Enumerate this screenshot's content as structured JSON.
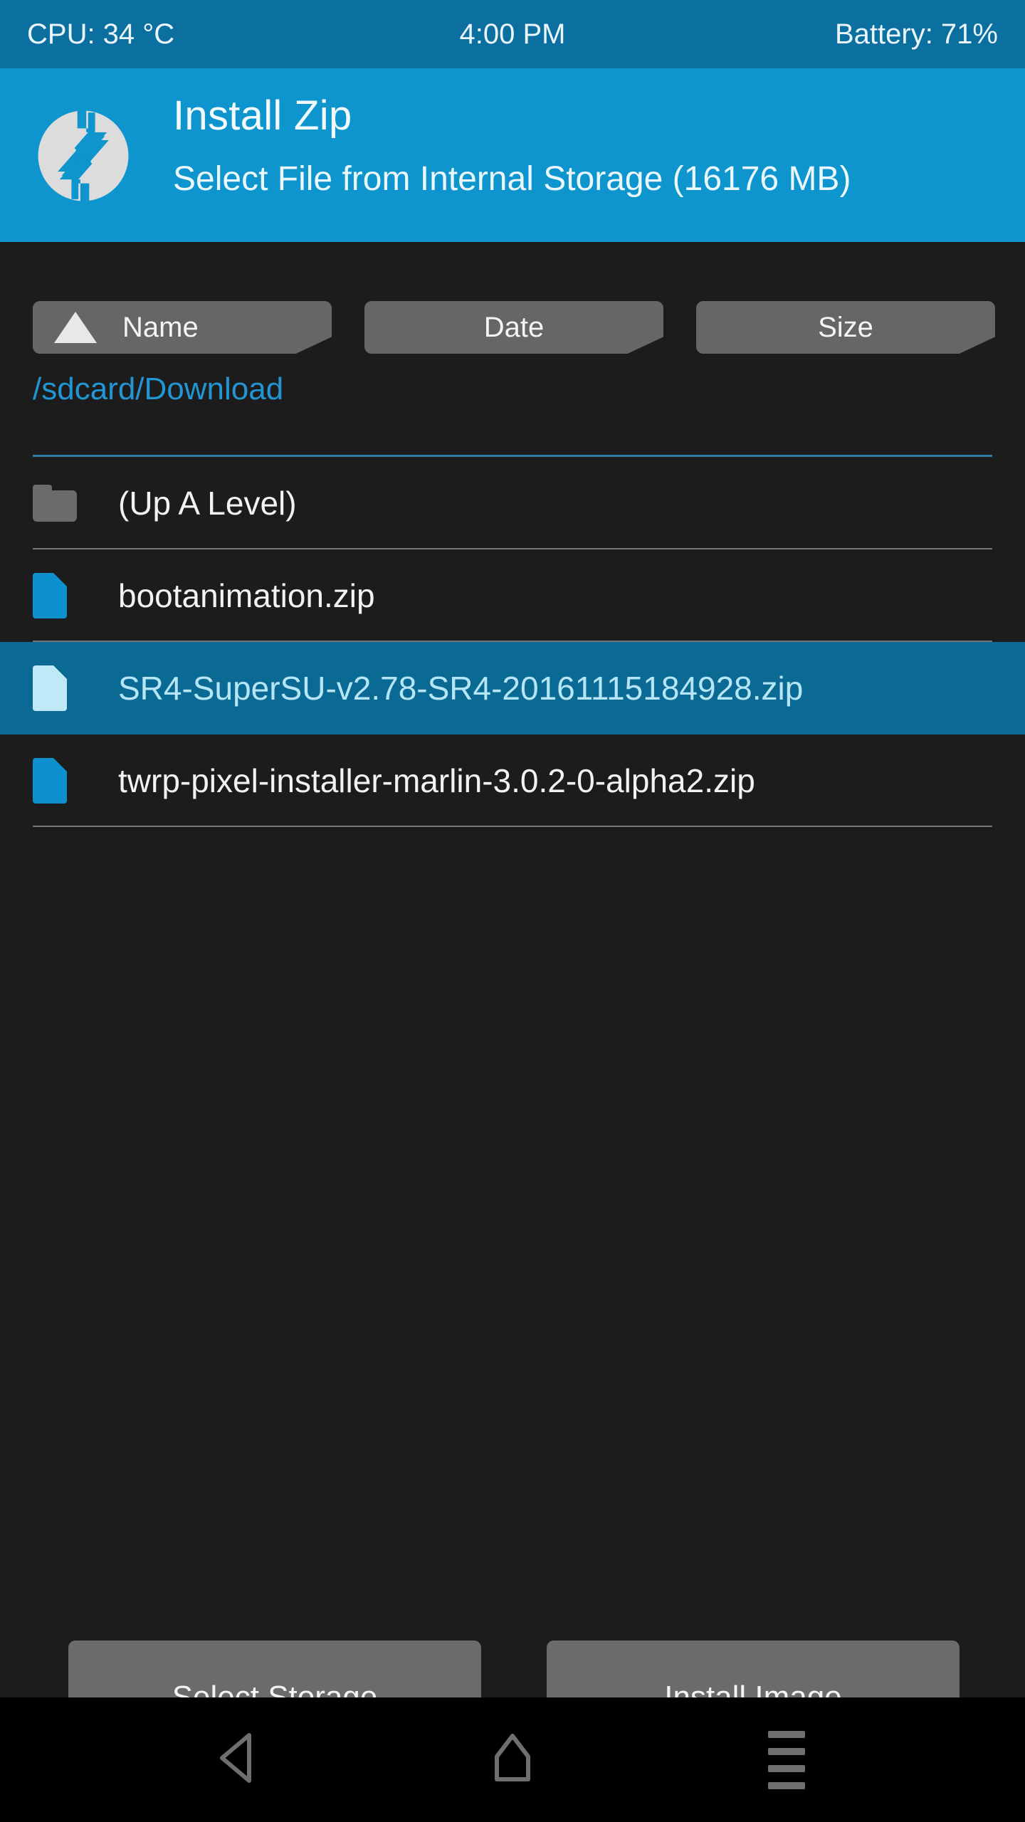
{
  "statusbar": {
    "cpu": "CPU: 34 °C",
    "clock": "4:00 PM",
    "battery": "Battery: 71%",
    "background_color": "#0b6fa0"
  },
  "header": {
    "logo_icon": "twrp-logo-icon",
    "title": "Install Zip",
    "subtitle": "Select File from Internal Storage (16176 MB)",
    "background_color": "#0e95ce"
  },
  "sort_bar": {
    "buttons": [
      {
        "label": "Name",
        "icon": "sort-ascending-triangle-icon",
        "active": true
      },
      {
        "label": "Date",
        "icon": "",
        "active": false
      },
      {
        "label": "Size",
        "icon": "",
        "active": false
      }
    ]
  },
  "path": {
    "value": "/sdcard/Download",
    "color": "#2196d3"
  },
  "file_list": {
    "rows": [
      {
        "label": "(Up A Level)",
        "icon": "folder-icon",
        "type": "folder",
        "selected": false
      },
      {
        "label": "bootanimation.zip",
        "icon": "file-icon",
        "type": "file",
        "selected": false
      },
      {
        "label": "SR4-SuperSU-v2.78-SR4-20161115184928.zip",
        "icon": "file-icon",
        "type": "file",
        "selected": true
      },
      {
        "label": "twrp-pixel-installer-marlin-3.0.2-0-alpha2.zip",
        "icon": "file-icon",
        "type": "file",
        "selected": false
      }
    ],
    "selected_background_color": "#0a6a94",
    "selected_text_color": "#b6e6f5"
  },
  "bottom_buttons": {
    "select_storage": "Select Storage",
    "install_image": "Install Image"
  },
  "navbar": {
    "back_icon": "back-triangle-icon",
    "home_icon": "home-icon",
    "menu_icon": "menu-icon"
  }
}
